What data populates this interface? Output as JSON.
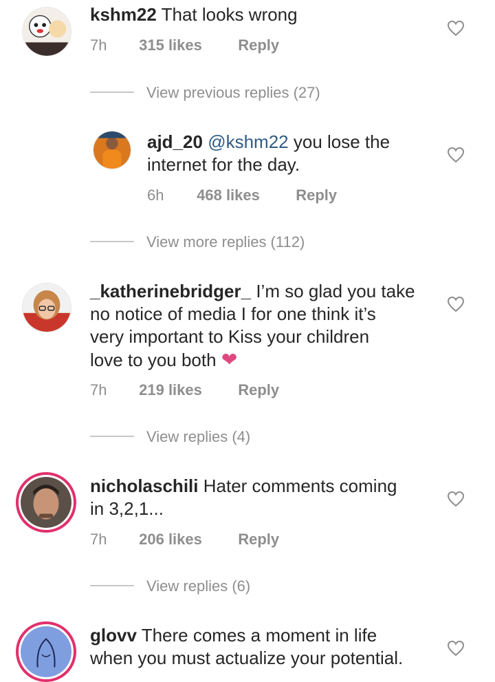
{
  "comments": [
    {
      "username": "kshm22",
      "text": "That looks wrong",
      "time": "7h",
      "likes": "315 likes",
      "reply": "Reply"
    },
    {
      "username": "ajd_20",
      "mention": "@kshm22",
      "text_line1": "you lose the",
      "text_line2": "internet for the day.",
      "time": "6h",
      "likes": "468 likes",
      "reply": "Reply"
    },
    {
      "username": "_katherinebridger_",
      "text_line1": "I’m so glad you take",
      "text_line2": "no notice of media I for one think it’s",
      "text_line3": "very important to Kiss your children",
      "text_line4": "love to you both",
      "emoji": "❤",
      "time": "7h",
      "likes": "219 likes",
      "reply": "Reply"
    },
    {
      "username": "nicholaschili",
      "text_line1": "Hater comments coming",
      "text_line2": "in 3,2,1...",
      "time": "7h",
      "likes": "206 likes",
      "reply": "Reply"
    },
    {
      "username": "glovv",
      "text_line1": "There comes a moment in life",
      "text_line2": "when you must actualize your potential."
    }
  ],
  "view_links": {
    "previous_replies": "View previous replies (27)",
    "more_replies": "View more replies (112)",
    "replies_katherine": "View replies (4)",
    "replies_nicholas": "View replies (6)"
  },
  "colors": {
    "text": "#262626",
    "secondary": "#8e8e8e",
    "mention": "#2e5b87",
    "story_ring": "#e1306c",
    "emoji_heart": "#e0487f"
  }
}
